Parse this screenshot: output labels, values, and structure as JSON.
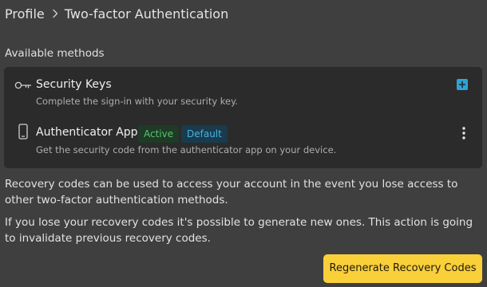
{
  "breadcrumb": {
    "parent": "Profile",
    "current": "Two-factor Authentication"
  },
  "methods": {
    "section_title": "Available methods",
    "items": [
      {
        "name": "Security Keys",
        "description": "Complete the sign-in with your security key.",
        "icon": "key-icon",
        "action_icon": "plus-icon"
      },
      {
        "name": "Authenticator App",
        "description": "Get the security code from the authenticator app on your device.",
        "icon": "smartphone-icon",
        "badges": [
          "Active",
          "Default"
        ],
        "action_icon": "kebab-menu-icon"
      }
    ]
  },
  "recovery": {
    "paragraph_1": "Recovery codes can be used to access your account in the event you lose access to other two-factor authentication methods.",
    "paragraph_2": "If you lose your recovery codes it's possible to generate new ones. This action is going to invalidate previous recovery codes.",
    "button_label": "Regenerate Recovery Codes"
  },
  "colors": {
    "background": "#3f3f40",
    "card": "#2b2b2c",
    "accent_button": "#f9cf3a",
    "active_badge_text": "#58c36a",
    "default_badge_text": "#47b3e3",
    "add_button": "#2ea3d6"
  }
}
